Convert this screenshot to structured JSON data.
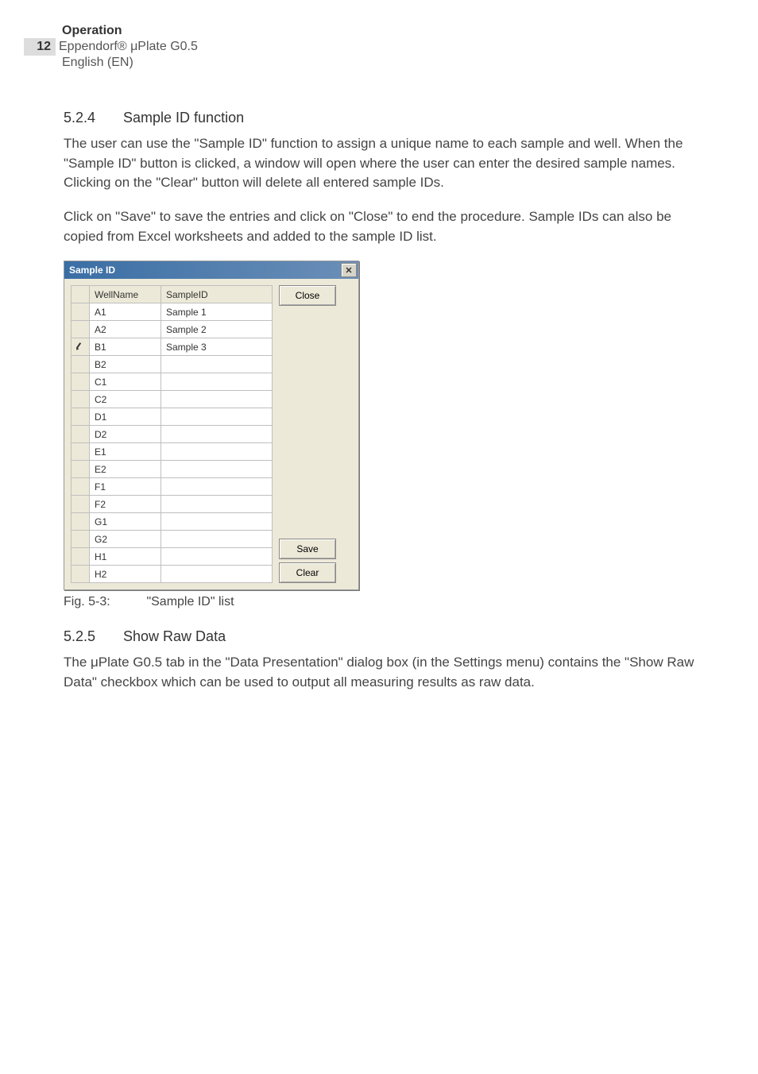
{
  "header": {
    "section": "Operation",
    "page_number": "12",
    "product": "Eppendorf® μPlate G0.5",
    "language": "English (EN)"
  },
  "section_524": {
    "number": "5.2.4",
    "title": "Sample ID function",
    "para1": "The user can use the \"Sample ID\" function to assign a unique name to each sample and well. When the \"Sample ID\" button is clicked, a window will open where the user can enter the desired sample names. Clicking on the \"Clear\" button will delete all entered sample IDs.",
    "para2": "Click on \"Save\" to save the entries and click on \"Close\" to end the procedure. Sample IDs can also be copied from Excel worksheets and added to the sample ID list."
  },
  "dialog": {
    "title": "Sample ID",
    "close_x": "✕",
    "col_well": "WellName",
    "col_sample": "SampleID",
    "rows": [
      {
        "marker": "",
        "well": "A1",
        "sample": "Sample 1"
      },
      {
        "marker": "",
        "well": "A2",
        "sample": "Sample 2"
      },
      {
        "marker": "✎",
        "well": "B1",
        "sample": "Sample 3"
      },
      {
        "marker": "",
        "well": "B2",
        "sample": ""
      },
      {
        "marker": "",
        "well": "C1",
        "sample": ""
      },
      {
        "marker": "",
        "well": "C2",
        "sample": ""
      },
      {
        "marker": "",
        "well": "D1",
        "sample": ""
      },
      {
        "marker": "",
        "well": "D2",
        "sample": ""
      },
      {
        "marker": "",
        "well": "E1",
        "sample": ""
      },
      {
        "marker": "",
        "well": "E2",
        "sample": ""
      },
      {
        "marker": "",
        "well": "F1",
        "sample": ""
      },
      {
        "marker": "",
        "well": "F2",
        "sample": ""
      },
      {
        "marker": "",
        "well": "G1",
        "sample": ""
      },
      {
        "marker": "",
        "well": "G2",
        "sample": ""
      },
      {
        "marker": "",
        "well": "H1",
        "sample": ""
      },
      {
        "marker": "",
        "well": "H2",
        "sample": ""
      }
    ],
    "btn_close": "Close",
    "btn_save": "Save",
    "btn_clear": "Clear"
  },
  "figure": {
    "number": "Fig. 5-3:",
    "caption": "\"Sample ID\" list"
  },
  "section_525": {
    "number": "5.2.5",
    "title": "Show Raw Data",
    "para1": "The μPlate G0.5 tab in the \"Data Presentation\" dialog box (in the Settings menu) contains the \"Show Raw Data\" checkbox which can be used to output all measuring results as raw data."
  }
}
